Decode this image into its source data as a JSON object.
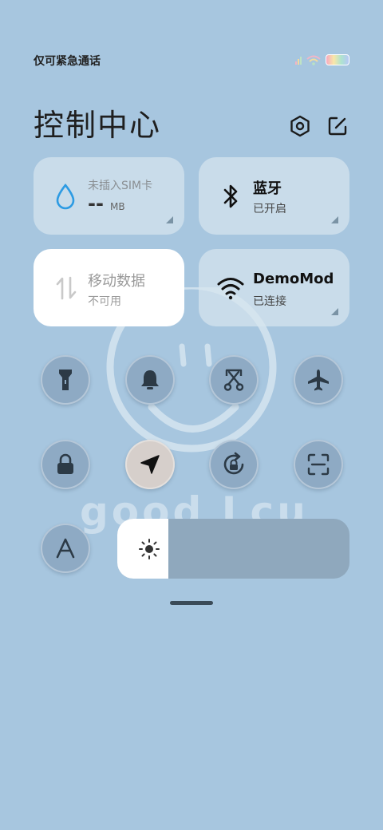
{
  "status_bar": {
    "carrier_text": "仅可紧急通话"
  },
  "header": {
    "title": "控制中心",
    "settings_icon": "hexagon-settings-icon",
    "edit_icon": "edit-icon"
  },
  "tiles": {
    "data_usage": {
      "label": "未插入SIM卡",
      "value": "--",
      "unit": "MB",
      "icon": "water-drop-icon"
    },
    "bluetooth": {
      "label": "蓝牙",
      "status": "已开启",
      "icon": "bluetooth-icon"
    },
    "mobile_data": {
      "label": "移动数据",
      "status": "不可用",
      "icon": "data-arrows-icon"
    },
    "wifi": {
      "label": "DemoMod",
      "status": "已连接",
      "icon": "wifi-icon"
    }
  },
  "toggles": [
    {
      "name": "flashlight",
      "icon": "flashlight-icon",
      "active": false
    },
    {
      "name": "ringer",
      "icon": "bell-icon",
      "active": false
    },
    {
      "name": "screenshot",
      "icon": "scissors-icon",
      "active": false
    },
    {
      "name": "airplane",
      "icon": "airplane-icon",
      "active": false
    },
    {
      "name": "lock",
      "icon": "lock-icon",
      "active": false
    },
    {
      "name": "location",
      "icon": "location-arrow-icon",
      "active": true
    },
    {
      "name": "rotation-lock",
      "icon": "rotation-lock-icon",
      "active": false
    },
    {
      "name": "scanner",
      "icon": "scan-icon",
      "active": false
    },
    {
      "name": "font",
      "icon": "font-a-icon",
      "active": false
    }
  ],
  "brightness": {
    "level": 0.22,
    "icon": "sun-icon"
  },
  "wallpaper": {
    "text": "good Lcuk"
  },
  "colors": {
    "background": "#a7c6df",
    "tile": "#d7e5ee",
    "toggle": "#8eaac4",
    "active_toggle": "#d6cfcb"
  }
}
